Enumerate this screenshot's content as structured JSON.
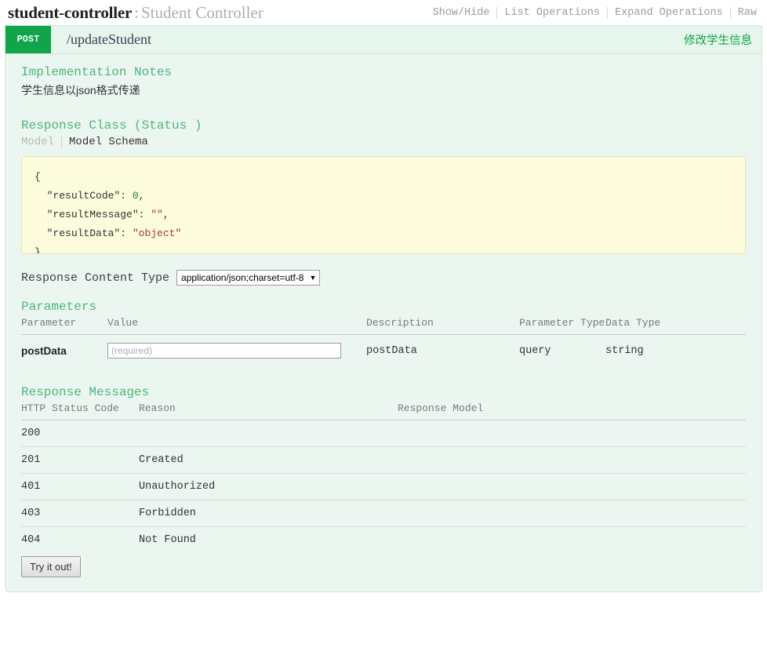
{
  "resource": {
    "name": "student-controller",
    "separator": ":",
    "description": "Student Controller",
    "options": [
      {
        "label": "Show/Hide"
      },
      {
        "label": "List Operations"
      },
      {
        "label": "Expand Operations"
      },
      {
        "label": "Raw"
      }
    ]
  },
  "operation": {
    "method": "POST",
    "path": "/updateStudent",
    "summary": "修改学生信息",
    "method_color": "#10a54a",
    "summary_color": "#10a54a",
    "implementation_notes": {
      "title": "Implementation Notes",
      "text": "学生信息以json格式传递"
    },
    "response_class": {
      "title": "Response Class (Status )",
      "tabs": [
        {
          "label": "Model",
          "active": false
        },
        {
          "label": "Model Schema",
          "active": true
        }
      ],
      "signature_lines": [
        {
          "punc": "{"
        },
        {
          "key": "\"resultCode\"",
          "colon": ": ",
          "num": "0",
          "tail": ","
        },
        {
          "key": "\"resultMessage\"",
          "colon": ": ",
          "str": "\"\"",
          "tail": ","
        },
        {
          "key": "\"resultData\"",
          "colon": ": ",
          "str": "\"object\"",
          "tail": ""
        },
        {
          "punc": "}"
        }
      ]
    },
    "response_content_type": {
      "label": "Response Content Type",
      "selected": "application/json;charset=utf-8",
      "caret": "▼"
    },
    "parameters": {
      "title": "Parameters",
      "headers": [
        "Parameter",
        "Value",
        "Description",
        "Parameter Type",
        "Data Type"
      ],
      "rows": [
        {
          "parameter": "postData",
          "value_placeholder": "(required)",
          "value": "",
          "description": "postData",
          "parameter_type": "query",
          "data_type": "string"
        }
      ]
    },
    "response_messages": {
      "title": "Response Messages",
      "headers": [
        "HTTP Status Code",
        "Reason",
        "Response Model"
      ],
      "rows": [
        {
          "code": "200",
          "reason": "",
          "model": ""
        },
        {
          "code": "201",
          "reason": "Created",
          "model": ""
        },
        {
          "code": "401",
          "reason": "Unauthorized",
          "model": ""
        },
        {
          "code": "403",
          "reason": "Forbidden",
          "model": ""
        },
        {
          "code": "404",
          "reason": "Not Found",
          "model": ""
        }
      ]
    },
    "submit_label": "Try it out!"
  }
}
